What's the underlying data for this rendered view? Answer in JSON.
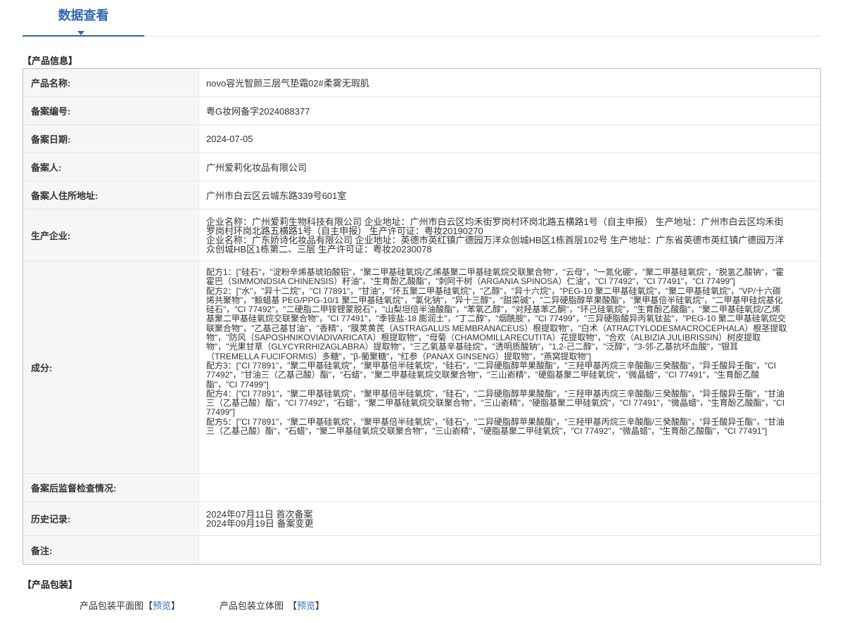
{
  "tab": {
    "title": "数据查看"
  },
  "colors": {
    "accent": "#2d66ad",
    "link": "#2a6fc4",
    "table_border": "#a9c2de",
    "label_background": "#f6f6f6"
  },
  "product_info": {
    "heading": "【产品信息】",
    "product_name": {
      "label": "产品名称:",
      "value": "novo容光智颜三层气垫霜02#柔雾无瑕肌"
    },
    "filing_number": {
      "label": "备案编号:",
      "value": "粤G妆网备字2024088377"
    },
    "filing_date": {
      "label": "备案日期:",
      "value": "2024-07-05"
    },
    "filer": {
      "label": "备案人:",
      "value": "广州爱莉化妆品有限公司"
    },
    "filer_address": {
      "label": "备案人住所地址:",
      "value": "广州市白云区云城东路339号601室"
    },
    "manufacturers": {
      "label": "生产企业:",
      "entries": [
        "企业名称：广州爱莉生物科技有限公司 企业地址：广州市白云区均禾街罗岗村环岗北路五横路1号（自主申报） 生产地址：广州市白云区均禾街罗岗村环岗北路五横路1号（自主申报） 生产许可证：粤妆20190270",
        "企业名称：广东娇诗化妆品有限公司 企业地址：英德市英红镇广德园万洋众创城HB区1栋首层102号 生产地址：广东省英德市英红镇广德园万洋众创城HB区1栋第二、三层 生产许可证：粤妆20230078"
      ]
    },
    "ingredients": {
      "label": "成分:",
      "formulas": [
        "配方1：[\"硅石\"，\"淀粉辛烯基琥珀酸铝\"，\"聚二甲基硅氧烷/乙烯基聚二甲基硅氧烷交联聚合物\"，\"云母\"，\"一氮化硼\"，\"聚二甲基硅氧烷\"，\"脱氢乙酸钠\"，\"霍霍巴（SIMMONDSIA CHINENSIS）籽油\"，\"生育酚乙酸酯\"，\"刺阿干树（ARGANIA SPINOSA）仁油\"，\"CI 77492\"，\"CI 77491\"，\"CI 77499\"]",
        "配方2：[\"水\"，\"异十二烷\"，\"CI 77891\"，\"甘油\"，\"环五聚二甲基硅氧烷\"，\"乙醇\"，\"异十六烷\"，\"PEG-10 聚二甲基硅氧烷\"，\"聚二甲基硅氧烷\"，\"VP/十六碳烯共聚物\"，\"鲸蜡基 PEG/PPG-10/1 聚二甲基硅氧烷\"，\"氯化钠\"，\"异十三醇\"，\"甜菜碱\"，\"二异硬脂醇苹果酸酯\"，\"聚甲基倍半硅氧烷\"，\"二甲基甲硅烷基化硅石\"，\"CI 77492\"，\"二硬脂二甲铵锂蒙脱石\"，\"山梨坦倍半油酸酯\"，\"苯氧乙醇\"，\"对羟基苯乙酮\"，\"环己硅氧烷\"，\"生育酚乙酸酯\"，\"聚二甲基硅氧烷/乙烯基聚二甲基硅氧烷交联聚合物\"，\"CI 77491\"，\"季铵盐-18 膨润土\"，\"丁二醇\"，\"烟酰胺\"，\"CI 77499\"，\"三异硬脂酸异丙氧钛盐\"，\"PEG-10 聚二甲基硅氧烷交联聚合物\"，\"乙基己基甘油\"，\"香精\"，\"膜荚黄芪（ASTRAGALUS MEMBRANACEUS）根提取物\"，\"白术（ATRACTYLODESMACROCEPHALA）根茎提取物\"，\"防风（SAPOSHNIKOVIADIVARICATA）根提取物\"，\"母菊（CHAMOMILLARECUTITA）花提取物\"，\"合欢（ALBIZIA JULIBRISSIN）树皮提取物\"，\"光果甘草（GLYCYRRHIZAGLABRA）提取物\"，\"三乙氧基辛基硅烷\"，\"透明质酸钠\"，\"1,2-己二醇\"，\"泛醇\"，\"3-邻-乙基抗坏血酸\"，\"银耳（TREMELLA FUCIFORMIS）多糖\"，\"β-葡聚糖\"，\"红参（PANAX GINSENG）提取物\"，\"燕窝提取物\"]",
        "配方3：[\"CI 77891\"，\"聚二甲基硅氧烷\"，\"聚甲基倍半硅氧烷\"，\"硅石\"，\"二异硬脂醇苹果酸酯\"，\"三羟甲基丙烷三辛酸酯/三癸酸酯\"，\"异壬酸异壬酯\"，\"CI 77492\"，\"甘油三（乙基己酸）酯\"，\"石蜡\"，\"聚二甲基硅氧烷交联聚合物\"，\"三山嵛精\"，\"硬脂基聚二甲硅氧烷\"，\"微晶蜡\"，\"CI 77491\"，\"生育酚乙酸酯\"，\"CI 77499\"]",
        "配方4：[\"CI 77891\"，\"聚二甲基硅氧烷\"，\"聚甲基倍半硅氧烷\"，\"硅石\"，\"二异硬脂醇苹果酸酯\"，\"三羟甲基丙烷三辛酸酯/三癸酸酯\"，\"异壬酸异壬酯\"，\"甘油三（乙基己酸）酯\"，\"CI 77492\"，\"石蜡\"，\"聚二甲基硅氧烷交联聚合物\"，\"三山嵛精\"，\"硬脂基聚二甲硅氧烷\"，\"CI 77491\"，\"微晶蜡\"，\"生育酚乙酸酯\"，\"CI 77499\"]",
        "配方5：[\"CI 77891\"，\"聚二甲基硅氧烷\"，\"聚甲基倍半硅氧烷\"，\"硅石\"，\"二异硬脂醇苹果酸酯\"，\"三羟甲基丙烷三辛酸酯/三癸酸酯\"，\"异壬酸异壬酯\"，\"甘油三（乙基己酸）酯\"，\"石蜡\"，\"聚二甲基硅氧烷交联聚合物\"，\"三山嵛精\"，\"硬脂基聚二甲硅氧烷\"，\"CI 77492\"，\"微晶蜡\"，\"生育酚乙酸酯\"，\"CI 77491\"]"
      ]
    },
    "post_filing_inspection": {
      "label": "备案后监督检查情况:",
      "value": ""
    },
    "history": {
      "label": "历史记录:",
      "entries": [
        "2024年07月11日 首次备案",
        "2024年09月19日 备案变更"
      ]
    },
    "remarks": {
      "label": "备注:",
      "value": ""
    }
  },
  "packaging": {
    "heading": "【产品包装】",
    "items": [
      {
        "label": "产品包装平面图",
        "bracket_open": "【",
        "link": "预览",
        "bracket_close": "】"
      },
      {
        "label": "产品包装立体图",
        "bracket_open": "【",
        "link": "预览",
        "bracket_close": "】"
      }
    ]
  }
}
